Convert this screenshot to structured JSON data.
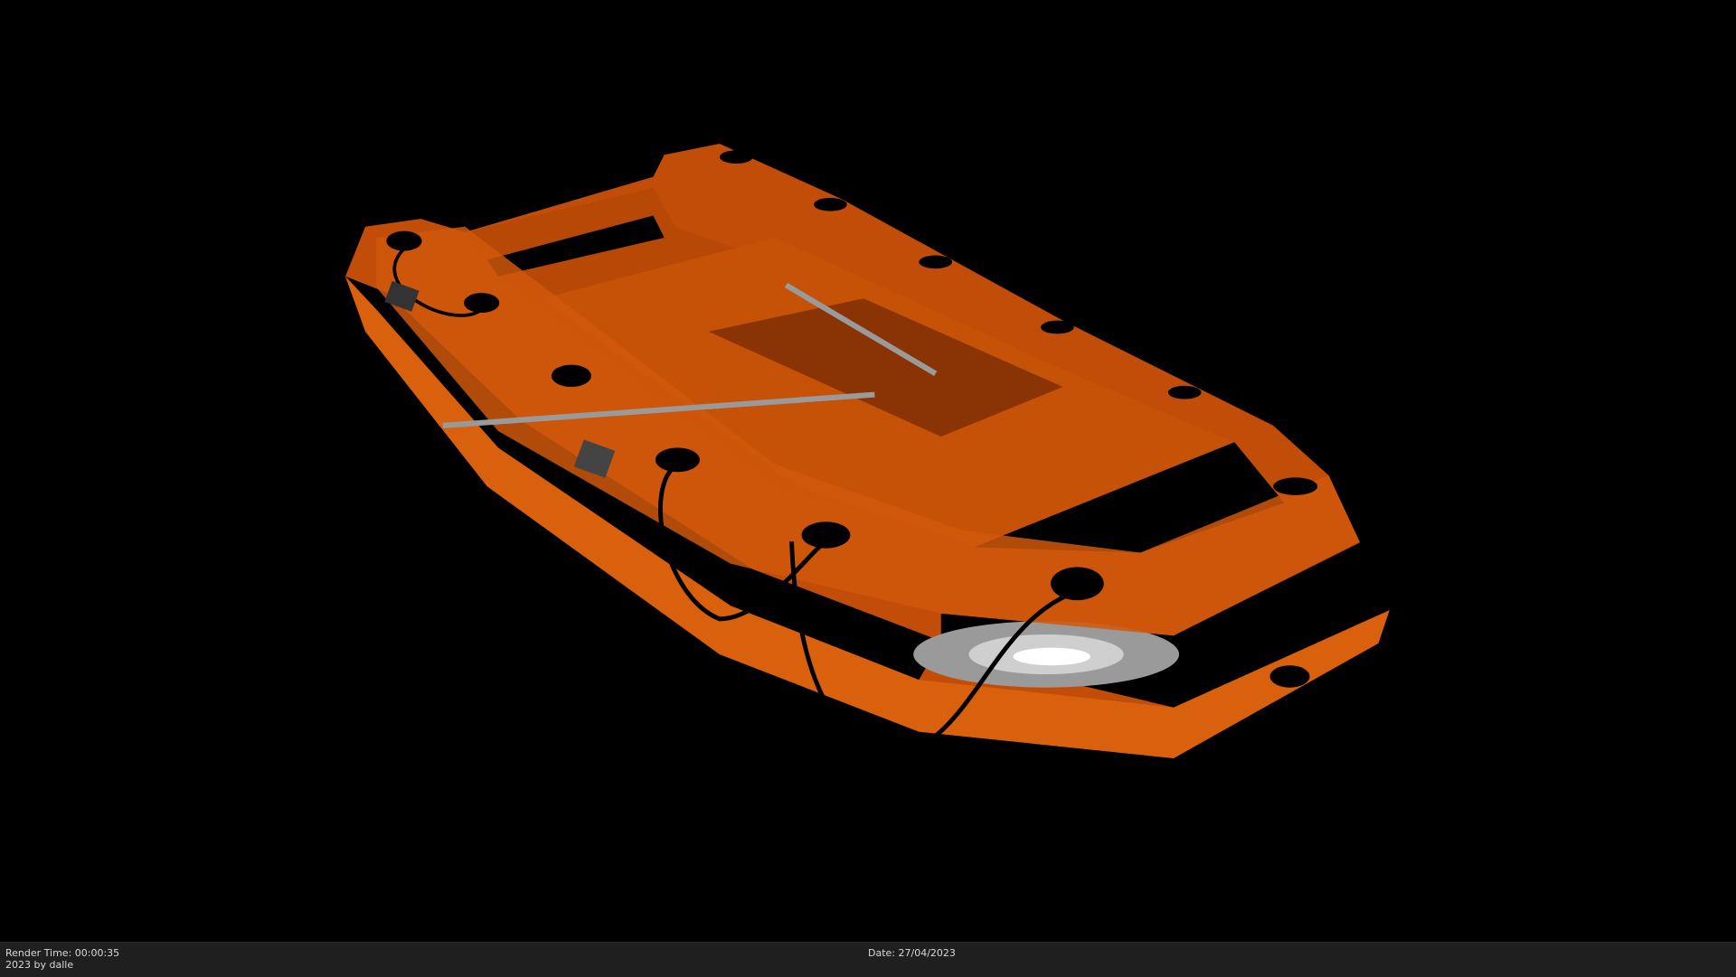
{
  "viewport": {
    "subject": "inflatable-boat-render",
    "colors": {
      "hull": "#c8500a",
      "hull_light": "#e0640e",
      "hull_dark": "#8a3406",
      "background": "#000000"
    }
  },
  "status": {
    "render_time": "Render Time: 00:00:35",
    "credit": "2023 by dalle",
    "date": "Date: 27/04/2023"
  }
}
